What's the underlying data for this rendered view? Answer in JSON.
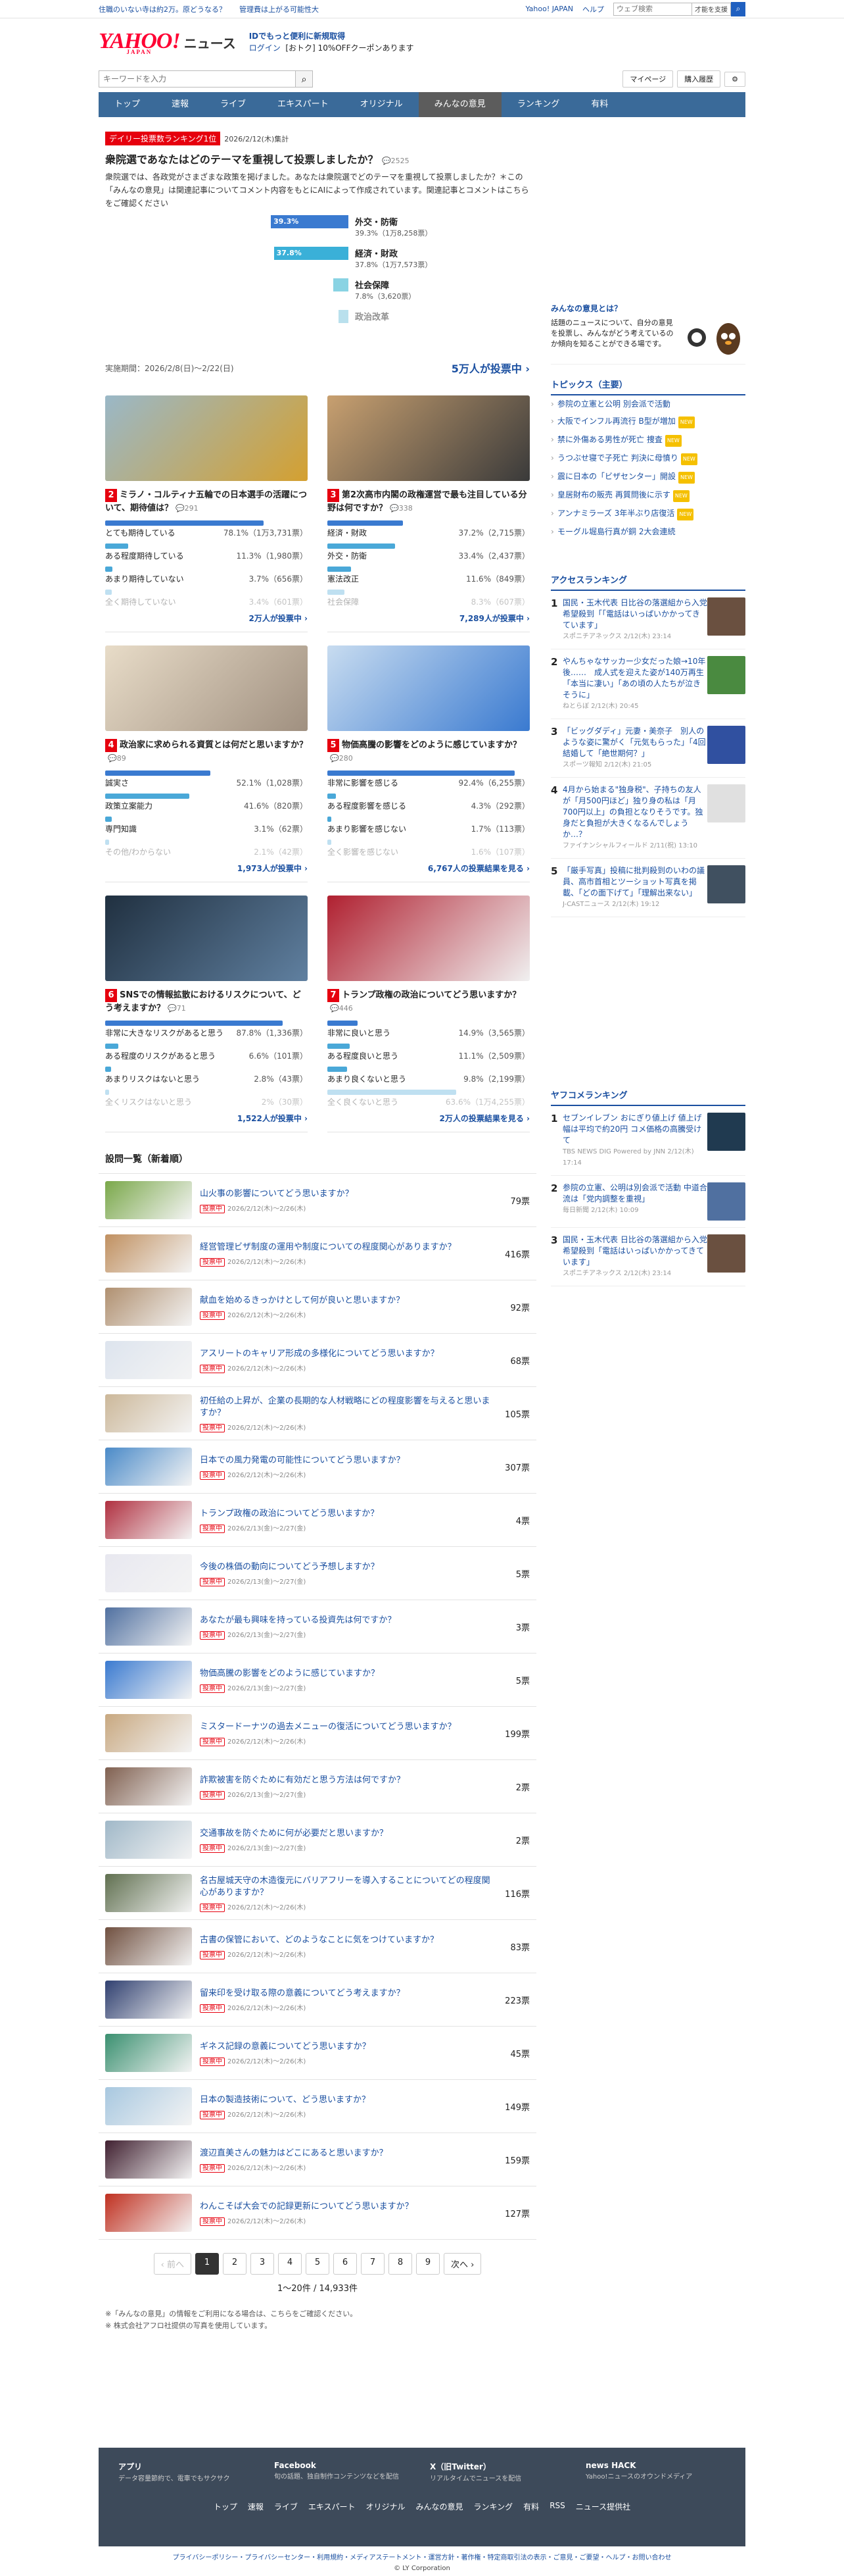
{
  "topbar": {
    "ad1": "住職のいない寺は約2万。原どうなる？",
    "ad2": "管理費は上がる可能性大",
    "yahoo": "Yahoo! JAPAN",
    "help": "ヘルプ",
    "search_placeholder": "ウェブ検索",
    "search_btn": "才能を支援"
  },
  "header": {
    "logo": "YAHOO!",
    "logo_sub": "JAPAN",
    "service": "ニュース",
    "promo": "IDでもっと便利に新規取得",
    "login": "ログイン",
    "coupon": "[おトク] 10%OFFクーポンあります"
  },
  "search": {
    "placeholder": "キーワードを入力",
    "mypage": "マイページ",
    "history": "購入履歴"
  },
  "nav": [
    "トップ",
    "速報",
    "ライブ",
    "エキスパート",
    "オリジナル",
    "みんなの意見",
    "ランキング",
    "有料"
  ],
  "hero": {
    "badge": "デイリー投票数ランキング1位",
    "date": "2026/2/12(木)集計",
    "title": "衆院選であなたはどのテーマを重視して投票しましたか？",
    "comments": "2525",
    "desc": "衆院選では、各政党がさまざまな政策を掲げました。あなたは衆院選でどのテーマを重視して投票しましたか？＊この「みんなの意見」は関連記事についてコメント内容をもとにAIによって作成されています。関連記事とコメントはこちらをご確認ください",
    "options": [
      {
        "pct": "39.3%",
        "label": "外交・防衛",
        "sub": "39.3%（1万8,258票）",
        "value": 39.3
      },
      {
        "pct": "37.8%",
        "label": "経済・財政",
        "sub": "37.8%（1万7,573票）",
        "value": 37.8
      },
      {
        "pct": "",
        "label": "社会保障",
        "sub": "7.8%（3,620票）",
        "value": 7.8
      },
      {
        "pct": "",
        "label": "政治改革",
        "sub": "",
        "value": 5
      }
    ],
    "period": "実施期間：2026/2/8(日)〜2/22(日)",
    "total": "5万人が投票中"
  },
  "cards": [
    {
      "num": "2",
      "title": "ミラノ・コルティナ五輪での日本選手の活躍について、期待値は？",
      "comments": "291",
      "options": [
        {
          "label": "とても期待している",
          "pct": "78.1%（1万3,731票）",
          "value": 78.1
        },
        {
          "label": "ある程度期待している",
          "pct": "11.3%（1,980票）",
          "value": 11.3
        },
        {
          "label": "あまり期待していない",
          "pct": "3.7%（656票）",
          "value": 3.7
        },
        {
          "label": "全く期待していない",
          "pct": "3.4%（601票）",
          "value": 3.4
        }
      ],
      "total": "2万人が投票中"
    },
    {
      "num": "3",
      "title": "第2次高市内閣の政権運営で最も注目している分野は何ですか？",
      "comments": "338",
      "options": [
        {
          "label": "経済・財政",
          "pct": "37.2%（2,715票）",
          "value": 37.2
        },
        {
          "label": "外交・防衛",
          "pct": "33.4%（2,437票）",
          "value": 33.4
        },
        {
          "label": "憲法改正",
          "pct": "11.6%（849票）",
          "value": 11.6
        },
        {
          "label": "社会保障",
          "pct": "8.3%（607票）",
          "value": 8.3
        }
      ],
      "total": "7,289人が投票中"
    },
    {
      "num": "4",
      "title": "政治家に求められる資質とは何だと思いますか？",
      "comments": "89",
      "options": [
        {
          "label": "誠実さ",
          "pct": "52.1%（1,028票）",
          "value": 52.1
        },
        {
          "label": "政策立案能力",
          "pct": "41.6%（820票）",
          "value": 41.6
        },
        {
          "label": "専門知識",
          "pct": "3.1%（62票）",
          "value": 3.1
        },
        {
          "label": "その他/わからない",
          "pct": "2.1%（42票）",
          "value": 2.1
        }
      ],
      "total": "1,973人が投票中"
    },
    {
      "num": "5",
      "title": "物価高騰の影響をどのように感じていますか？",
      "comments": "280",
      "options": [
        {
          "label": "非常に影響を感じる",
          "pct": "92.4%（6,255票）",
          "value": 92.4
        },
        {
          "label": "ある程度影響を感じる",
          "pct": "4.3%（292票）",
          "value": 4.3
        },
        {
          "label": "あまり影響を感じない",
          "pct": "1.7%（113票）",
          "value": 1.7
        },
        {
          "label": "全く影響を感じない",
          "pct": "1.6%（107票）",
          "value": 1.6
        }
      ],
      "total": "6,767人の投票結果を見る"
    },
    {
      "num": "6",
      "title": "SNSでの情報拡散におけるリスクについて、どう考えますか？",
      "comments": "71",
      "options": [
        {
          "label": "非常に大きなリスクがあると思う",
          "pct": "87.8%（1,336票）",
          "value": 87.8
        },
        {
          "label": "ある程度のリスクがあると思う",
          "pct": "6.6%（101票）",
          "value": 6.6
        },
        {
          "label": "あまりリスクはないと思う",
          "pct": "2.8%（43票）",
          "value": 2.8
        },
        {
          "label": "全くリスクはないと思う",
          "pct": "2%（30票）",
          "value": 2
        }
      ],
      "total": "1,522人が投票中"
    },
    {
      "num": "7",
      "title": "トランプ政権の政治についてどう思いますか？",
      "comments": "446",
      "options": [
        {
          "label": "非常に良いと思う",
          "pct": "14.9%（3,565票）",
          "value": 14.9
        },
        {
          "label": "ある程度良いと思う",
          "pct": "11.1%（2,509票）",
          "value": 11.1
        },
        {
          "label": "あまり良くないと思う",
          "pct": "9.8%（2,199票）",
          "value": 9.8
        },
        {
          "label": "全く良くないと思う",
          "pct": "63.6%（1万4,255票）",
          "value": 63.6
        }
      ],
      "total": "2万人の投票結果を見る"
    }
  ],
  "list_title": "設問一覧（新着順）",
  "list": [
    {
      "t": "山火事の影響についてどう思いますか？",
      "s": "2026/2/12(木)〜2/26(木)",
      "v": "79票",
      "c": "#7aa84a"
    },
    {
      "t": "経営管理ビザ制度の運用や制度についての程度関心がありますか？",
      "s": "2026/2/12(木)〜2/26(木)",
      "v": "416票",
      "c": "#c09060"
    },
    {
      "t": "献血を始めるきっかけとして何が良いと思いますか？",
      "s": "2026/2/12(木)〜2/26(木)",
      "v": "92票",
      "c": "#b09070"
    },
    {
      "t": "アスリートのキャリア形成の多様化についてどう思いますか？",
      "s": "2026/2/12(木)〜2/26(木)",
      "v": "68票",
      "c": "#dde4ee"
    },
    {
      "t": "初任給の上昇が、企業の長期的な人材戦略にどの程度影響を与えると思いますか？",
      "s": "2026/2/12(木)〜2/26(木)",
      "v": "105票",
      "c": "#ccb89a"
    },
    {
      "t": "日本での風力発電の可能性についてどう思いますか？",
      "s": "2026/2/12(木)〜2/26(木)",
      "v": "307票",
      "c": "#4a8ac8"
    },
    {
      "t": "トランプ政権の政治についてどう思いますか？",
      "s": "2026/2/13(金)〜2/27(金)",
      "v": "4票",
      "c": "#b03040"
    },
    {
      "t": "今後の株価の動向についてどう予想しますか？",
      "s": "2026/2/13(金)〜2/27(金)",
      "v": "5票",
      "c": "#e8e8f0"
    },
    {
      "t": "あなたが最も興味を持っている投資先は何ですか？",
      "s": "2026/2/13(金)〜2/27(金)",
      "v": "3票",
      "c": "#5070a0"
    },
    {
      "t": "物価高騰の影響をどのように感じていますか？",
      "s": "2026/2/13(金)〜2/27(金)",
      "v": "5票",
      "c": "#3a7ad0"
    },
    {
      "t": "ミスタードーナツの過去メニューの復活についてどう思いますか？",
      "s": "2026/2/12(木)〜2/26(木)",
      "v": "199票",
      "c": "#c8a880"
    },
    {
      "t": "詐欺被害を防ぐために有効だと思う方法は何ですか？",
      "s": "2026/2/13(金)〜2/27(金)",
      "v": "2票",
      "c": "#806050"
    },
    {
      "t": "交通事故を防ぐために何が必要だと思いますか？",
      "s": "2026/2/13(金)〜2/27(金)",
      "v": "2票",
      "c": "#a0b8c8"
    },
    {
      "t": "名古屋城天守の木造復元にバリアフリーを導入することについてどの程度関心がありますか？",
      "s": "2026/2/12(木)〜2/26(木)",
      "v": "116票",
      "c": "#607050"
    },
    {
      "t": "古書の保管において、どのようなことに気をつけていますか？",
      "s": "2026/2/12(木)〜2/26(木)",
      "v": "83票",
      "c": "#705040"
    },
    {
      "t": "留来印を受け取る際の意義についてどう考えますか？",
      "s": "2026/2/12(木)〜2/26(木)",
      "v": "223票",
      "c": "#304070"
    },
    {
      "t": "ギネス記録の意義についてどう思いますか？",
      "s": "2026/2/12(木)〜2/26(木)",
      "v": "45票",
      "c": "#3a9070"
    },
    {
      "t": "日本の製造技術について、どう思いますか？",
      "s": "2026/2/12(木)〜2/26(木)",
      "v": "149票",
      "c": "#a8c8e0"
    },
    {
      "t": "渡辺直美さんの魅力はどこにあると思いますか？",
      "s": "2026/2/12(木)〜2/26(木)",
      "v": "159票",
      "c": "#402030"
    },
    {
      "t": "わんこそば大会での記録更新についてどう思いますか？",
      "s": "2026/2/12(木)〜2/26(木)",
      "v": "127票",
      "c": "#c03020"
    }
  ],
  "list_badge": "投票中",
  "pager": {
    "prev": "‹ 前へ",
    "pages": [
      "1",
      "2",
      "3",
      "4",
      "5",
      "6",
      "7",
      "8",
      "9"
    ],
    "next": "次へ ›",
    "count": "1〜20件 / 14,933件"
  },
  "notes": [
    "※「みんなの意見」の情報をご利用になる場合は、こちらをご確認ください。",
    "※ 株式会社アフロ社提供の写真を使用しています。"
  ],
  "side": {
    "about_title": "みんなの意見とは？",
    "about_text": "話題のニュースについて、自分の意見を投票し、みんながどう考えているのか傾向を知ることができる場です。",
    "topics_title": "トピックス（主要）",
    "topics": [
      "参院の立憲と公明 別会派で活動",
      "大阪でインフル再流行 B型が増加",
      "禁に外傷ある男性が死亡 捜査",
      "うつぶせ寝で子死亡 判決に母憤り",
      "震に日本の「ビザセンター」開設",
      "皇居財布の販売 再質問後に示す",
      "アンナミラーズ 3年半ぶり店復活",
      "モーグル堀島行真が銅 2大会連続"
    ],
    "access_title": "アクセスランキング",
    "access": [
      {
        "t": "国民・玉木代表 日比谷の落選組から入党希望殺到「「電話はいっぱいかかってきています」",
        "m": "スポニチアネックス 2/12(木) 23:14"
      },
      {
        "t": "やんちゃなサッカー少女だった娘→10年後……　成人式を迎えた姿が140万再生「本当に凄い」「あの頃の人たちが泣きそうに」",
        "m": "ねとらぼ 2/12(木) 20:45"
      },
      {
        "t": "「ビッグダディ」元妻・美奈子　別人のような姿に驚がく「元気もらった」「4回結婚して「絶世期何？」",
        "m": "スポーツ報知 2/12(木) 21:05"
      },
      {
        "t": "4月から始まる\"独身税\"、子持ちの友人が「月500円ほど」独り身の私は「月700円以上」の負担となりそうです。独身だと負担が大きくなるんでしょうか…？",
        "m": "ファイナンシャルフィールド 2/11(祝) 13:10"
      },
      {
        "t": "「厳手写真」投稿に批判殺到のいわの議員、高市首相とツーショット写真を掲載、「どの面下げて」「理解出来ない」",
        "m": "J-CASTニュース 2/12(木) 19:12"
      }
    ],
    "yafoko_title": "ヤフコメランキング",
    "yafoko": [
      {
        "t": "セブンイレブン おにぎり値上げ 値上げ幅は平均で約20円 コメ価格の高騰受けて",
        "m": "TBS NEWS DIG Powered by JNN 2/12(木) 17:14"
      },
      {
        "t": "参院の立憲、公明は別会派で活動 中道合流は「党内調整を重視」",
        "m": "毎日新聞 2/12(木) 10:09"
      },
      {
        "t": "国民・玉木代表 日比谷の落選組から入党希望殺到「電話はいっぱいかかってきています」",
        "m": "スポニチアネックス 2/12(木) 23:14"
      }
    ]
  },
  "footer": {
    "apps": [
      {
        "name": "アプリ",
        "desc": "データ容量節約で、電車でもサクサク"
      },
      {
        "name": "Facebook",
        "desc": "旬の話題、独自制作コンテンツなどを配信"
      },
      {
        "name": "X（旧Twitter）",
        "desc": "リアルタイムでニュースを配信"
      },
      {
        "name": "news HACK",
        "desc": "Yahoo!ニュースのオウンドメディア"
      }
    ],
    "nav": [
      "トップ",
      "速報",
      "ライブ",
      "エキスパート",
      "オリジナル",
      "みんなの意見",
      "ランキング",
      "有料",
      "RSS",
      "ニュース提供社"
    ],
    "links": "プライバシーポリシー・プライバシーセンター・利用規約・メディアステートメント・運営方針・著作権・特定商取引法の表示・ご意見・ご要望・ヘルプ・お問い合わせ",
    "copy": "© LY Corporation"
  }
}
